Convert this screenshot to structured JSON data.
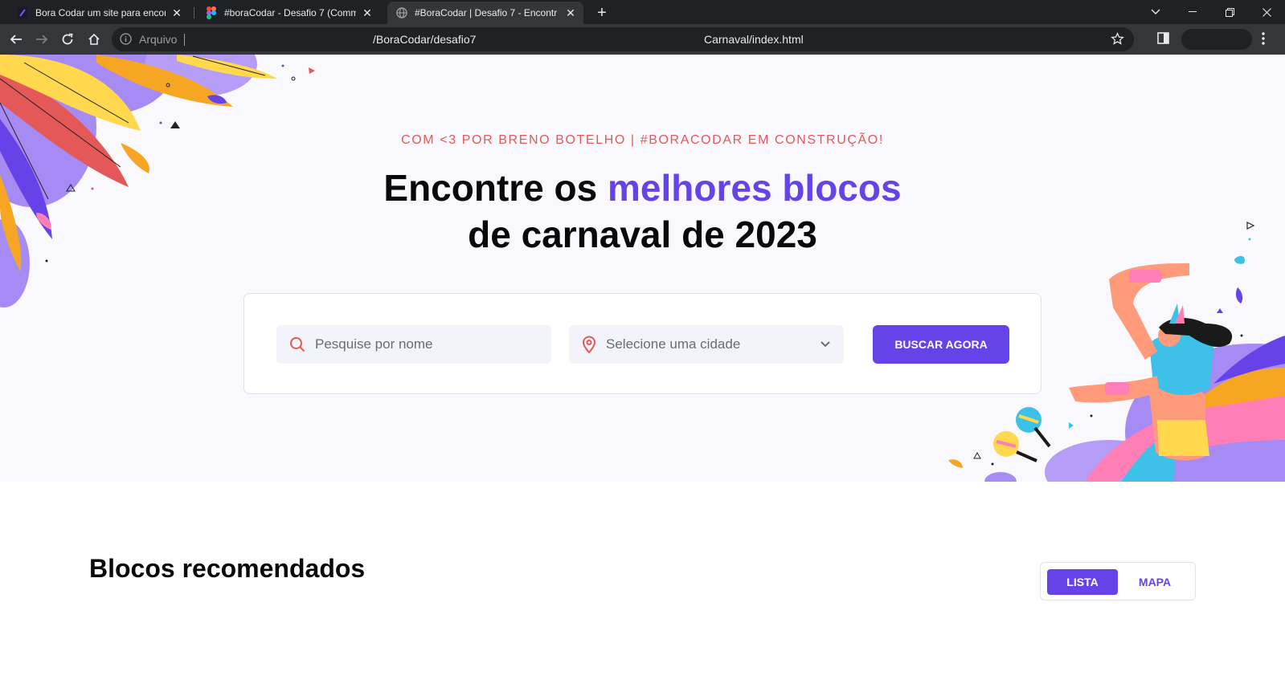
{
  "browser": {
    "tabs": [
      {
        "title": "Bora Codar um site para encontrar",
        "active": false,
        "favicon": "boracodar-icon"
      },
      {
        "title": "#boraCodar - Desafio 7 (Commu",
        "active": false,
        "favicon": "figma-icon"
      },
      {
        "title": "#BoraCodar | Desafio 7 - Encontr",
        "active": true,
        "favicon": "globe-icon"
      }
    ],
    "url": {
      "scheme_label": "Arquivo",
      "path_part1": "/BoraCodar/desafio7",
      "path_part2": "Carnaval/index.html"
    }
  },
  "hero": {
    "eyebrow": "COM <3 POR BRENO BOTELHO | #BORACODAR EM CONSTRUÇÃO!",
    "headline_part1": "Encontre os ",
    "headline_highlight": "melhores blocos",
    "headline_part2": "de carnaval de 2023"
  },
  "search": {
    "name_placeholder": "Pesquise por nome",
    "city_placeholder": "Selecione uma cidade",
    "button_label": "BUSCAR AGORA"
  },
  "recommended": {
    "title": "Blocos recomendados",
    "view_toggle": {
      "list_label": "LISTA",
      "map_label": "MAPA",
      "selected": "LISTA"
    }
  },
  "colors": {
    "accent": "#6643e8",
    "eyebrow": "#e45858",
    "hero_bg": "#f8f8fd"
  }
}
